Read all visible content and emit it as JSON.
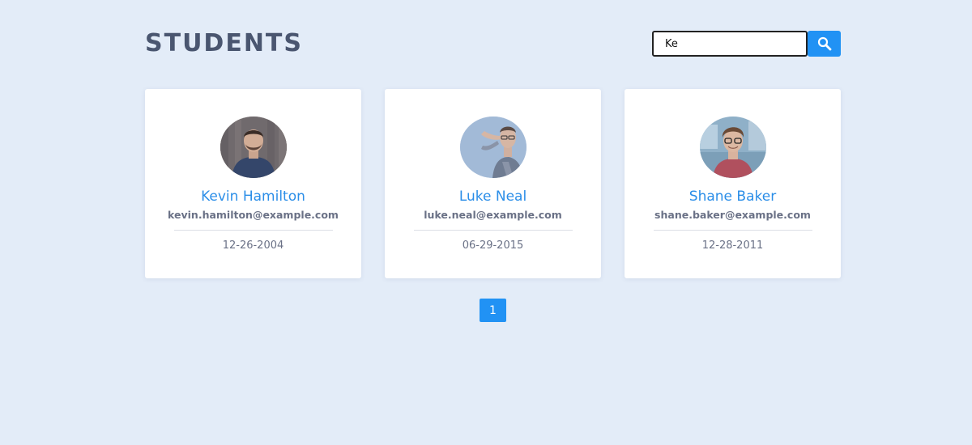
{
  "header": {
    "title": "STUDENTS"
  },
  "search": {
    "value": "Ke",
    "icon": "search-icon"
  },
  "students": [
    {
      "name": "Kevin Hamilton",
      "email": "kevin.hamilton@example.com",
      "date": "12-26-2004"
    },
    {
      "name": "Luke Neal",
      "email": "luke.neal@example.com",
      "date": "06-29-2015"
    },
    {
      "name": "Shane Baker",
      "email": "shane.baker@example.com",
      "date": "12-28-2011"
    }
  ],
  "pagination": {
    "current": "1"
  },
  "colors": {
    "background": "#e3ecf8",
    "accent": "#2192f4",
    "name_text": "#2b8ee8",
    "title_text": "#4a5670",
    "muted_text": "#6a7186"
  }
}
